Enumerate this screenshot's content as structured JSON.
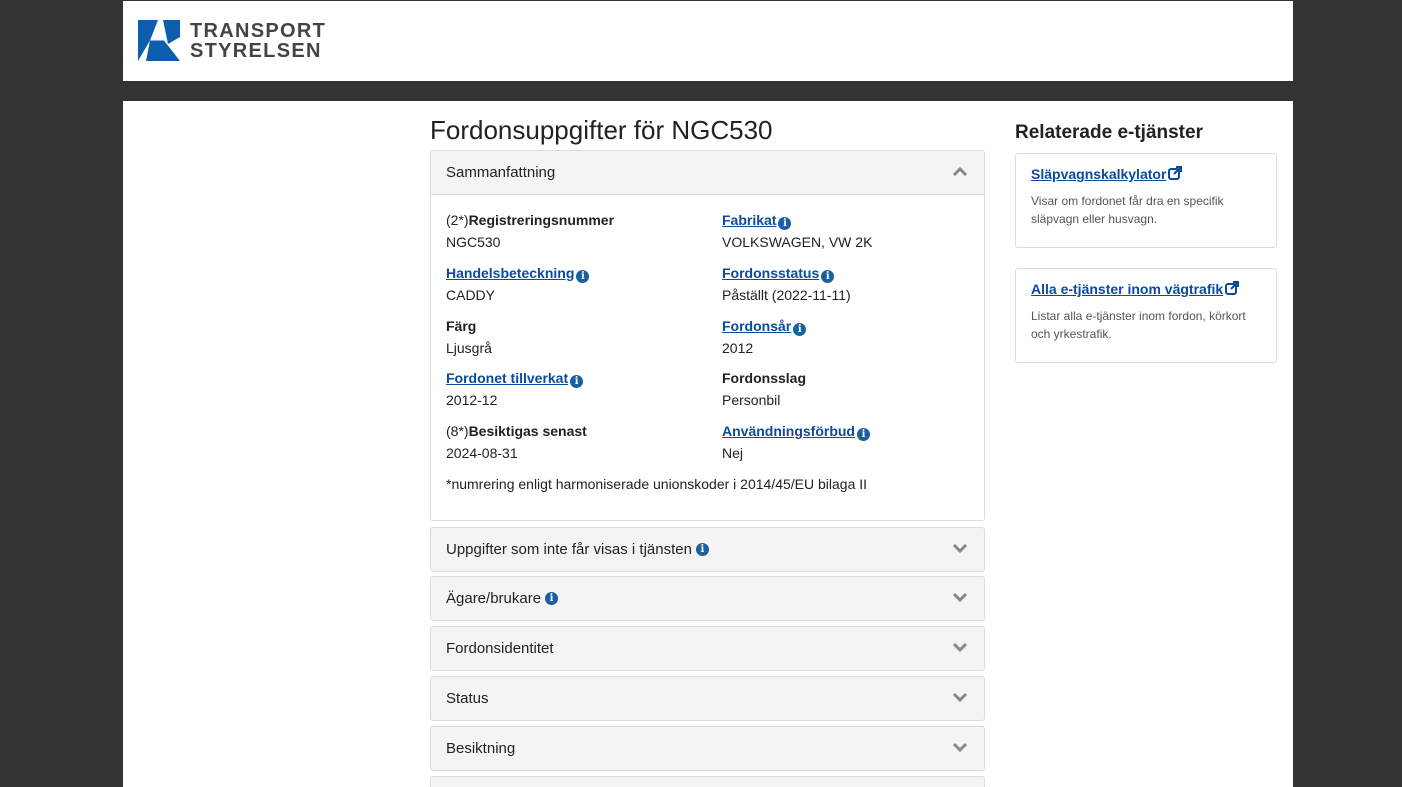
{
  "header": {
    "logo_line1": "TRANSPORT",
    "logo_line2": "STYRELSEN",
    "brand_color": "#0d5eaf"
  },
  "main": {
    "title": "Fordonsuppgifter för NGC530",
    "summary": {
      "heading": "Sammanfattning",
      "fields": {
        "reg": {
          "prefix": "(2*)",
          "label": "Registreringsnummer",
          "value": "NGC530"
        },
        "fabrikat": {
          "label": "Fabrikat",
          "value": "VOLKSWAGEN, VW 2K"
        },
        "handels": {
          "label": "Handelsbeteckning",
          "value": "CADDY"
        },
        "status": {
          "label": "Fordonsstatus",
          "value": "Påställt (2022-11-11)"
        },
        "farg": {
          "label": "Färg",
          "value": "Ljusgrå"
        },
        "ar": {
          "label": "Fordonsår",
          "value": "2012"
        },
        "tillverkat": {
          "label": "Fordonet tillverkat",
          "value": "2012-12"
        },
        "slag": {
          "label": "Fordonsslag",
          "value": "Personbil"
        },
        "besiktigas": {
          "prefix": "(8*)",
          "label": "Besiktigas senast",
          "value": "2024-08-31"
        },
        "forbud": {
          "label": "Användningsförbud",
          "value": "Nej"
        }
      },
      "footnote": "*numrering enligt harmoniserade unionskoder i 2014/45/EU bilaga II"
    },
    "sections": [
      "Uppgifter som inte får visas i tjänsten",
      "Ägare/brukare",
      "Fordonsidentitet",
      "Status",
      "Besiktning"
    ]
  },
  "sidebar": {
    "title": "Relaterade e-tjänster",
    "cards": [
      {
        "link": "Släpvagnskalkylator",
        "desc": "Visar om fordonet får dra en specifik släpvagn eller husvagn."
      },
      {
        "link": "Alla e-tjänster inom vägtrafik",
        "desc": "Listar alla e-tjänster inom fordon, körkort och yrkestrafik."
      }
    ]
  },
  "icons": {
    "info": "info-circle-icon",
    "chevron_up": "chevron-up-icon",
    "chevron_down": "chevron-down-icon",
    "external": "external-link-icon"
  }
}
